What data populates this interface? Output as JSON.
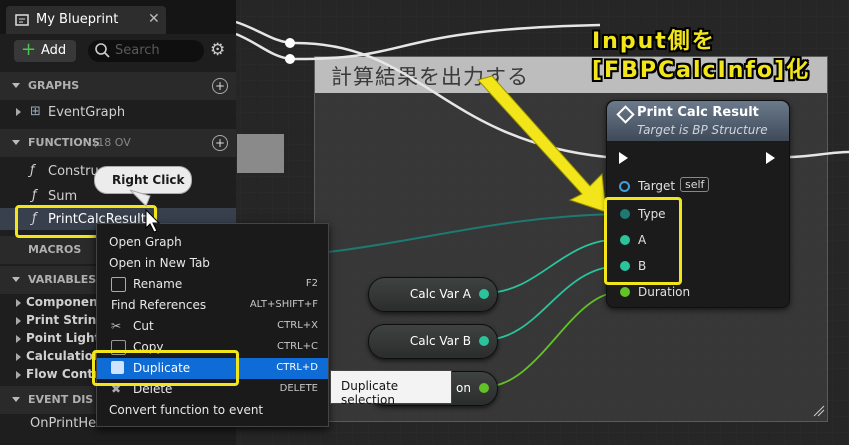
{
  "panel": {
    "tab_title": "My Blueprint",
    "add_label": "Add",
    "search_placeholder": "Search",
    "sections": {
      "graphs": "GRAPHS",
      "functions": "FUNCTIONS",
      "functions_count": "(18 OV",
      "macros": "MACROS",
      "variables": "VARIABLES",
      "event_dispatchers": "EVENT DIS"
    },
    "graph_items": [
      "EventGraph"
    ],
    "function_items": [
      "Constru",
      "Sum",
      "PrintCalcResult"
    ],
    "variable_items": [
      "Componen",
      "Print String",
      "Point Light",
      "Calculation",
      "Flow Contr"
    ],
    "dispatcher_items": [
      "OnPrintHe"
    ]
  },
  "context_menu": {
    "items": [
      {
        "label": "Open Graph",
        "shortcut": ""
      },
      {
        "label": "Open in New Tab",
        "shortcut": ""
      },
      {
        "label": "Rename",
        "shortcut": "F2"
      },
      {
        "label": "Find References",
        "shortcut": "ALT+SHIFT+F"
      },
      {
        "label": "Cut",
        "shortcut": "CTRL+X"
      },
      {
        "label": "Copy",
        "shortcut": "CTRL+C"
      },
      {
        "label": "Duplicate",
        "shortcut": "CTRL+D"
      },
      {
        "label": "Delete",
        "shortcut": "DELETE"
      },
      {
        "label": "Convert function to event",
        "shortcut": ""
      }
    ],
    "highlighted": "Duplicate"
  },
  "callouts": {
    "right_click": "Right Click",
    "tooltip": "Duplicate selection",
    "annotation_line1": "Input側を",
    "annotation_line2": "[FBPCalcInfo]化",
    "annotation_color": "#f2e61a"
  },
  "graph": {
    "comment_title": "計算結果を出力する",
    "node": {
      "title": "Print Calc Result",
      "subtitle": "Target is BP Structure",
      "pins": [
        "Target",
        "Type",
        "A",
        "B",
        "Duration"
      ],
      "self_label": "self"
    },
    "variables": [
      "Calc Var A",
      "Calc Var B"
    ],
    "partial_var_label": "on"
  }
}
